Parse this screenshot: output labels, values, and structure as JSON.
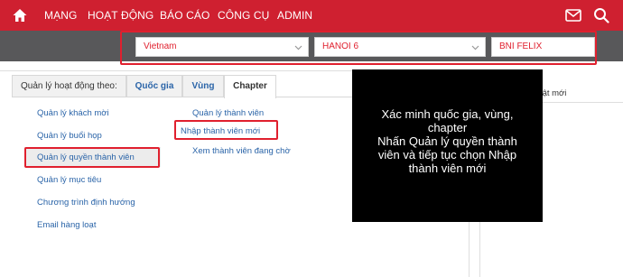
{
  "topbar": {
    "nav": [
      "MẠNG",
      "HOẠT ĐỘNG",
      "BÁO CÁO",
      "CÔNG CỤ",
      "ADMIN"
    ],
    "colors": {
      "bar": "#cf2030",
      "text": "#ffffff"
    },
    "icons": [
      "home-icon",
      "mail-icon",
      "search-icon"
    ]
  },
  "filters": {
    "country": "Vietnam",
    "region": "HANOI 6",
    "chapter": "BNI FELIX"
  },
  "tabs": {
    "lead": "Quản lý hoạt động theo:",
    "country": "Quốc gia",
    "region": "Vùng",
    "chapter": "Chapter"
  },
  "left_menu": [
    "Quản lý khách mời",
    "Quản lý buổi họp",
    "Quản lý quyền thành viên",
    "Quản lý mục tiêu",
    "Chương trình định hướng",
    "Email hàng loạt"
  ],
  "sub_menu": [
    "Quản lý thành viên",
    "Nhập thành viên mới",
    "Xem thành viên đang chờ"
  ],
  "right_panel": {
    "partial_text": "nhật mới"
  },
  "caption": {
    "lines": [
      "Xác minh quốc gia, vùng,",
      "chapter",
      "Nhấn Quản lý quyền thành",
      "viên và tiếp tục chọn Nhập",
      "thành viên mới"
    ]
  },
  "accent_color": "#e0202e",
  "link_color": "#2a64a8"
}
